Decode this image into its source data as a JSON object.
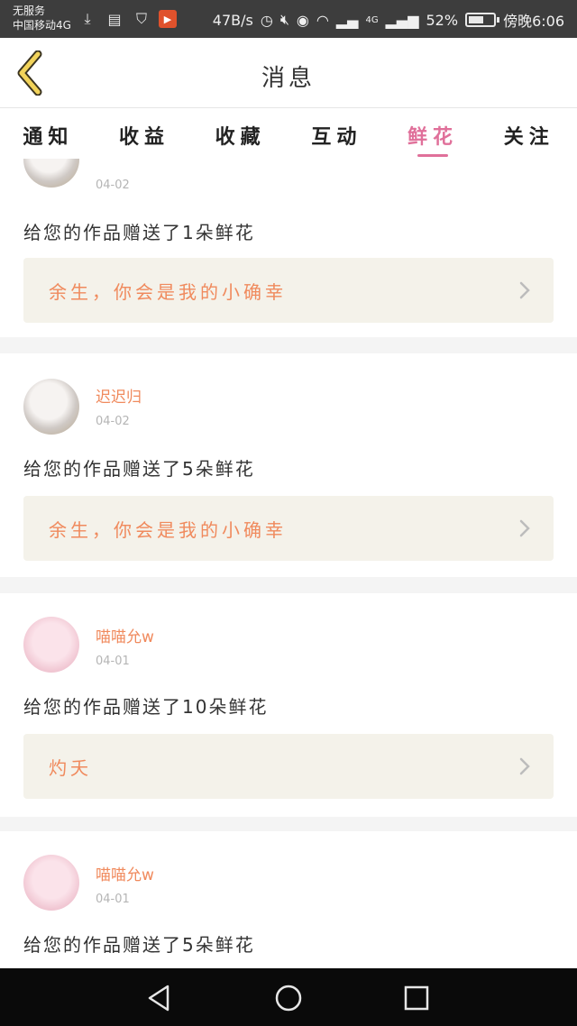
{
  "status_bar": {
    "carrier_line1": "无服务",
    "carrier_line2": "中国移动4G",
    "network_speed": "47B/s",
    "signal_label": "4G",
    "battery_percent": "52%",
    "battery_level": 0.52,
    "time": "傍晚6:06"
  },
  "header": {
    "title": "消息"
  },
  "tabs": [
    {
      "label": "通知",
      "active": false
    },
    {
      "label": "收益",
      "active": false
    },
    {
      "label": "收藏",
      "active": false
    },
    {
      "label": "互动",
      "active": false
    },
    {
      "label": "鲜花",
      "active": true
    },
    {
      "label": "关注",
      "active": false
    }
  ],
  "feed": [
    {
      "username": "",
      "date": "04-02",
      "message": "给您的作品赠送了1朵鲜花",
      "work_title": "余生，你会是我的小确幸",
      "avatar": "cat-avatar"
    },
    {
      "username": "迟迟归",
      "date": "04-02",
      "message": "给您的作品赠送了5朵鲜花",
      "work_title": "余生，你会是我的小确幸",
      "avatar": "cat-avatar"
    },
    {
      "username": "喵喵允w",
      "date": "04-01",
      "message": "给您的作品赠送了10朵鲜花",
      "work_title": "灼夭",
      "avatar": "anime-girl-avatar"
    },
    {
      "username": "喵喵允w",
      "date": "04-01",
      "message": "给您的作品赠送了5朵鲜花",
      "work_title": "",
      "avatar": "anime-girl-avatar"
    }
  ],
  "colors": {
    "accent": "#e0709a",
    "username": "#f08a5d",
    "work_bg": "#f4f2ea",
    "back_arrow": "#f2d35a"
  },
  "icons": {
    "back": "chevron-left-icon",
    "chevron": "chevron-right-icon",
    "nav_back": "triangle-back-icon",
    "nav_home": "circle-home-icon",
    "nav_recent": "square-recents-icon"
  }
}
